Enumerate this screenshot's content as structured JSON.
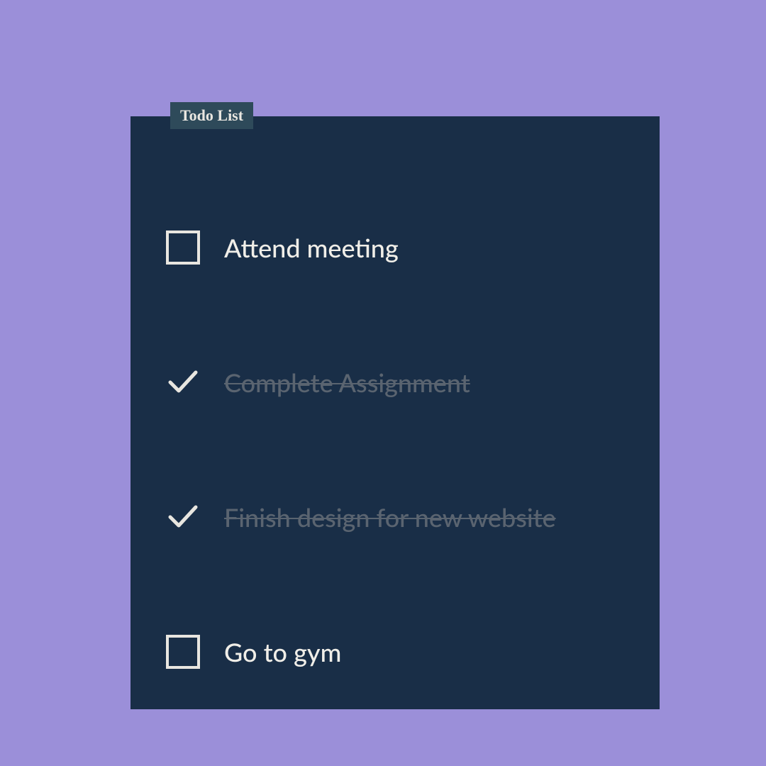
{
  "badge": {
    "label": "Todo List"
  },
  "todos": [
    {
      "label": "Attend meeting",
      "completed": false
    },
    {
      "label": "Complete Assignment",
      "completed": true
    },
    {
      "label": "Finish design for new website",
      "completed": true
    },
    {
      "label": "Go to gym",
      "completed": false
    }
  ]
}
